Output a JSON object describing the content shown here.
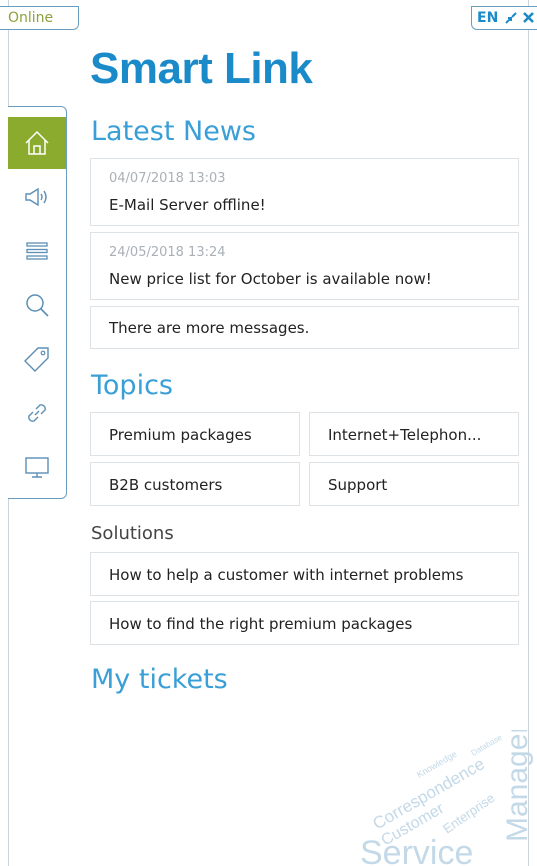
{
  "status": {
    "label": "Online"
  },
  "language": {
    "code": "EN"
  },
  "app": {
    "title": "Smart Link"
  },
  "sidebar": {
    "items": [
      {
        "name": "home",
        "icon": "home-icon",
        "active": true
      },
      {
        "name": "announcements",
        "icon": "megaphone-icon",
        "active": false
      },
      {
        "name": "list",
        "icon": "list-icon",
        "active": false
      },
      {
        "name": "search",
        "icon": "search-icon",
        "active": false
      },
      {
        "name": "tags",
        "icon": "tag-icon",
        "active": false
      },
      {
        "name": "links",
        "icon": "link-icon",
        "active": false
      },
      {
        "name": "display",
        "icon": "monitor-icon",
        "active": false
      }
    ]
  },
  "news": {
    "title": "Latest News",
    "items": [
      {
        "date": "04/07/2018 13:03",
        "text": "E-Mail Server offline!"
      },
      {
        "date": "24/05/2018 13:24",
        "text": "New price list for October is available now!"
      }
    ],
    "more": "There are more messages."
  },
  "topics": {
    "title": "Topics",
    "items": [
      "Premium packages",
      "Internet+Telephon...",
      "B2B customers",
      "Support"
    ]
  },
  "solutions": {
    "title": "Solutions",
    "items": [
      "How to help a customer with internet problems",
      "How to find the right premium packages"
    ]
  },
  "tickets": {
    "title": "My tickets"
  },
  "wordcloud": {
    "words": [
      "Service",
      "Management",
      "Correspondence",
      "Customer",
      "Enterprise",
      "Knowledge",
      "Database"
    ]
  },
  "colors": {
    "accent": "#1a8bc8",
    "active": "#8aab2e",
    "status": "#8aa33a",
    "border": "#6a9ec0"
  }
}
